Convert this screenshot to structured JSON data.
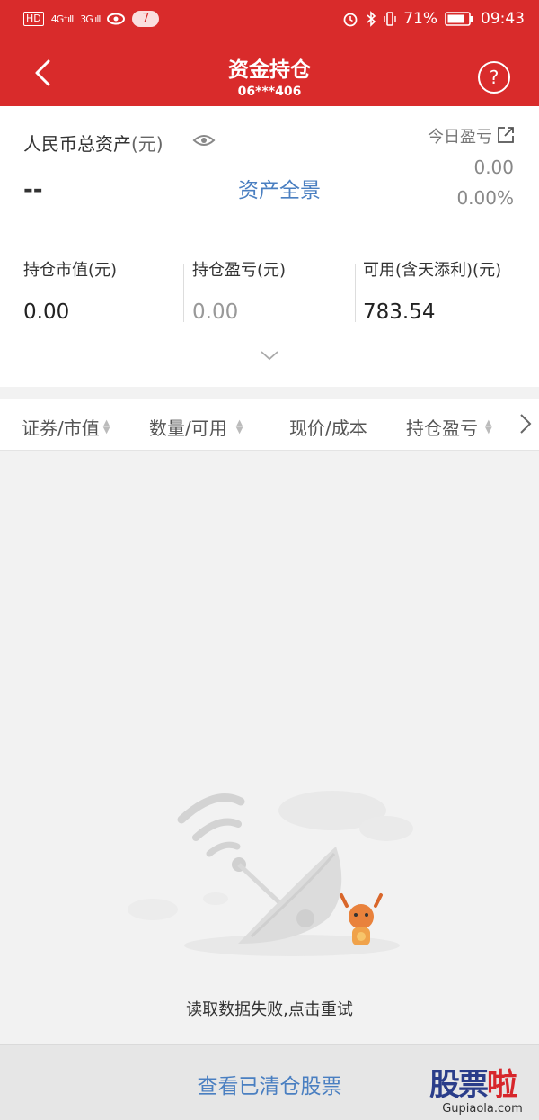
{
  "status_bar": {
    "hd1": "HD",
    "hd2": "D",
    "sig1": "4G⁺ıll",
    "sig2": "3G ıll",
    "notif_count": "7",
    "battery": "71%",
    "time": "09:43"
  },
  "header": {
    "title": "资金持仓",
    "account": "06***406",
    "help": "?"
  },
  "summary": {
    "total_label": "人民币总资产",
    "total_unit": "(元)",
    "total_value": "--",
    "panorama": "资产全景",
    "today_label": "今日盈亏",
    "today_value": "0.00",
    "today_pct": "0.00%",
    "metrics": [
      {
        "label": "持仓市值(元)",
        "value": "0.00"
      },
      {
        "label": "持仓盈亏(元)",
        "value": "0.00"
      },
      {
        "label": "可用(含天添利)(元)",
        "value": "783.54"
      }
    ]
  },
  "columns": [
    "证券/市值",
    "数量/可用",
    "现价/成本",
    "持仓盈亏"
  ],
  "empty_state": {
    "message": "读取数据失败,点击重试"
  },
  "bottom": {
    "cleared_button": "查看已清仓股票"
  },
  "watermark": {
    "main_a": "股票",
    "main_b": "啦",
    "sub": "Gupiaola.com"
  },
  "colors": {
    "brand_red": "#d92b2b",
    "link_blue": "#4a7fc1"
  }
}
